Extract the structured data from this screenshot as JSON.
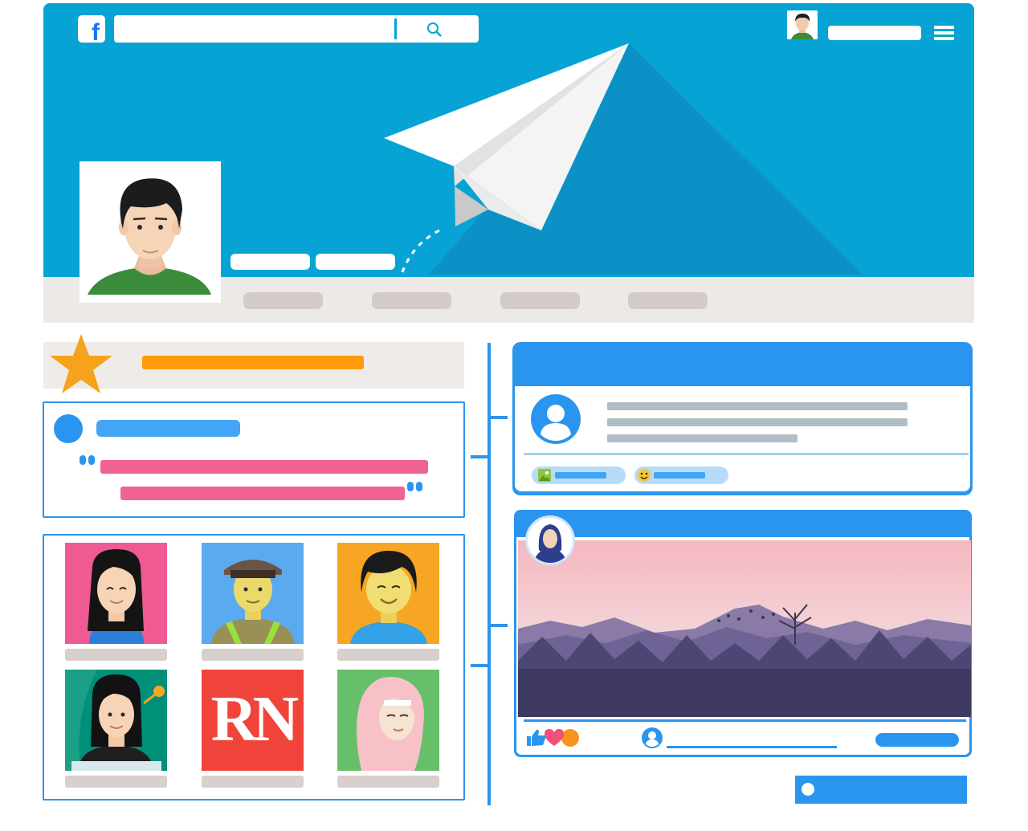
{
  "header": {
    "logo_letter": "f",
    "logo_icon": "facebook-logo",
    "search": {
      "value": "",
      "icon": "search-icon"
    },
    "account": {
      "avatar": "user-avatar-small",
      "name": ""
    },
    "menu_icon": "hamburger-menu-icon"
  },
  "cover": {
    "illustration": "paper-plane",
    "profile_photo": "profile-avatar-man-green-shirt"
  },
  "profile_tabs": [
    "",
    "",
    "",
    ""
  ],
  "featured": {
    "icon": "star-icon",
    "title": ""
  },
  "quote_card": {
    "name": "",
    "quote_lines": [
      "",
      ""
    ],
    "icons": [
      "quote-open-icon",
      "quote-close-icon"
    ]
  },
  "friends_grid": {
    "friends": [
      {
        "avatar": "woman-pink-bg",
        "caption": ""
      },
      {
        "avatar": "police-officer-blue-bg",
        "caption": ""
      },
      {
        "avatar": "smiling-man-orange-bg",
        "caption": ""
      },
      {
        "avatar": "woman-teal-bg",
        "caption": ""
      },
      {
        "avatar": "rn-logo-red-bg",
        "caption": "RN"
      },
      {
        "avatar": "woman-hijab-green-bg",
        "caption": ""
      }
    ]
  },
  "composer": {
    "avatar_icon": "user-placeholder-icon",
    "text_lines": [
      "",
      "",
      ""
    ],
    "actions": [
      {
        "icon": "photo-icon",
        "label": ""
      },
      {
        "icon": "emoji-icon",
        "label": ""
      }
    ]
  },
  "photo_post": {
    "author_avatar": "woman-hijab-avatar",
    "image": "mountain-landscape-sunset",
    "reactions": [
      "like-icon",
      "heart-icon",
      "reaction-orange-icon"
    ],
    "comment_placeholder": "",
    "share_label": ""
  },
  "footer_toggle": {
    "label": ""
  },
  "colors": {
    "header_blue": "#08a3d5",
    "accent_blue": "#2a95ef",
    "orange": "#ff9b0b",
    "pink": "#f06292",
    "gray_bar": "#b0bcc6"
  }
}
